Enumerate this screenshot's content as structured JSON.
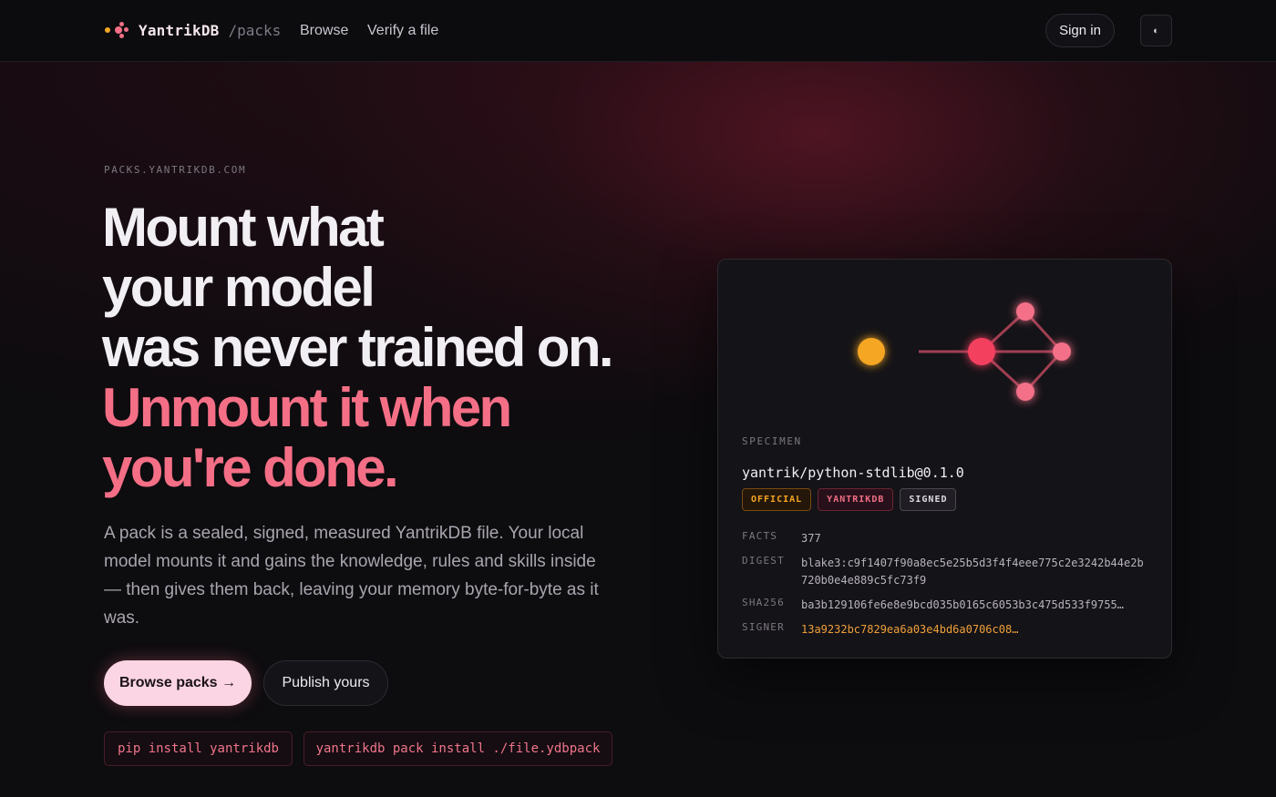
{
  "nav": {
    "brand": "YantrikDB",
    "brand_sub": "/packs",
    "links": [
      "Browse",
      "Verify a file"
    ],
    "sign_in": "Sign in",
    "theme_glyph": "◐",
    "theme_icon": "theme-toggle-icon"
  },
  "hero": {
    "eyebrow": "PACKS.YANTRIKDB.COM",
    "headline_lines": [
      "Mount what",
      "your model",
      "was never trained on."
    ],
    "headline_accent_lines": [
      "Unmount it when",
      "you're done."
    ],
    "lede": "A pack is a sealed, signed, measured YantrikDB file. Your local model mounts it and gains the knowledge, rules and skills inside — then gives them back, leaving your memory byte-for-byte as it was.",
    "primary_button": "Browse packs →",
    "secondary_button": "Publish yours",
    "commands": [
      "pip install yantrikdb",
      "yantrikdb pack install ./file.ydbpack"
    ]
  },
  "specimen": {
    "label": "SPECIMEN",
    "name": "yantrik/python-stdlib@0.1.0",
    "badges": [
      "OFFICIAL",
      "YANTRIKDB",
      "SIGNED"
    ],
    "fields": [
      {
        "key": "FACTS",
        "value": "377"
      },
      {
        "key": "DIGEST",
        "value": "blake3:c9f1407f90a8ec5e25b5d3f4f4eee775c2e3242b44e2b",
        "value2": "720b0e4e889c5fc73f9"
      },
      {
        "key": "SHA256",
        "value": "ba3b129106fe6e8e9bcd035b0165c6053b3c475d533f9755…"
      },
      {
        "key": "SIGNER",
        "value": "13a9232bc7829ea6a03e4bd6a0706c08…"
      }
    ]
  },
  "colors": {
    "accent_pink": "#f46f86",
    "accent_orange": "#f5a623",
    "primary_button_bg": "#fbd5e3",
    "background": "#0d0c0f"
  }
}
